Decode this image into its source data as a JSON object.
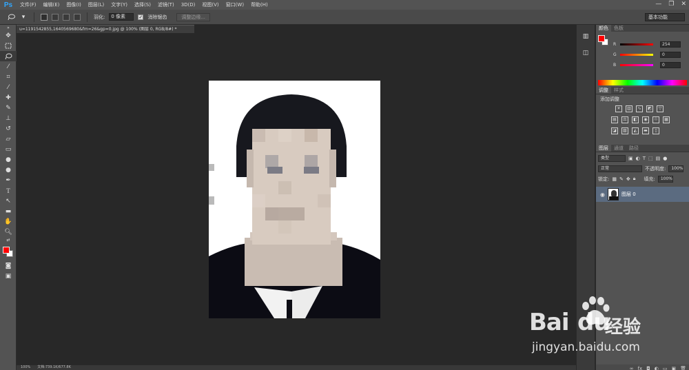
{
  "app": {
    "logo": "Ps"
  },
  "menu": [
    "文件(F)",
    "编辑(E)",
    "图像(I)",
    "图层(L)",
    "文字(Y)",
    "选择(S)",
    "滤镜(T)",
    "3D(D)",
    "视图(V)",
    "窗口(W)",
    "帮助(H)"
  ],
  "window_controls": {
    "minimize": "—",
    "restore": "❐",
    "close": "✕"
  },
  "options": {
    "feather_label": "羽化:",
    "feather_value": "0 像素",
    "antialias_label": "消除锯齿",
    "antialias_checked": true,
    "refine_button": "调整边缘...",
    "workspace": "基本功能"
  },
  "document": {
    "tab_title": "u=1191542855,1640569680&fm=26&gp=0.jpg @ 100% (图层 0, RGB/8#) *",
    "zoom": "100%",
    "doc_size": "文档:739.1K/677.8K"
  },
  "colors": {
    "foreground": "#fe0000",
    "background": "#ffffff",
    "accent_layer": "#5b6b80"
  },
  "color_panel": {
    "tabs": [
      "颜色",
      "色板"
    ],
    "R": {
      "label": "R",
      "value": "254"
    },
    "G": {
      "label": "G",
      "value": "0"
    },
    "B": {
      "label": "B",
      "value": "0"
    }
  },
  "adjustments_panel": {
    "tabs": [
      "调整",
      "样式"
    ],
    "title": "添加调整"
  },
  "layers_panel": {
    "tabs": [
      "图层",
      "通道",
      "路径"
    ],
    "filter_kind": "类型",
    "blend_mode": "正常",
    "opacity_label": "不透明度:",
    "opacity_value": "100%",
    "lock_label": "锁定:",
    "fill_label": "填充:",
    "fill_value": "100%",
    "layers": [
      {
        "name": "图层 0",
        "visible": true
      }
    ]
  },
  "watermark": {
    "brand_latin": "Bai",
    "brand_du": "du",
    "brand_cn": "经验",
    "url": "jingyan.baidu.com"
  }
}
